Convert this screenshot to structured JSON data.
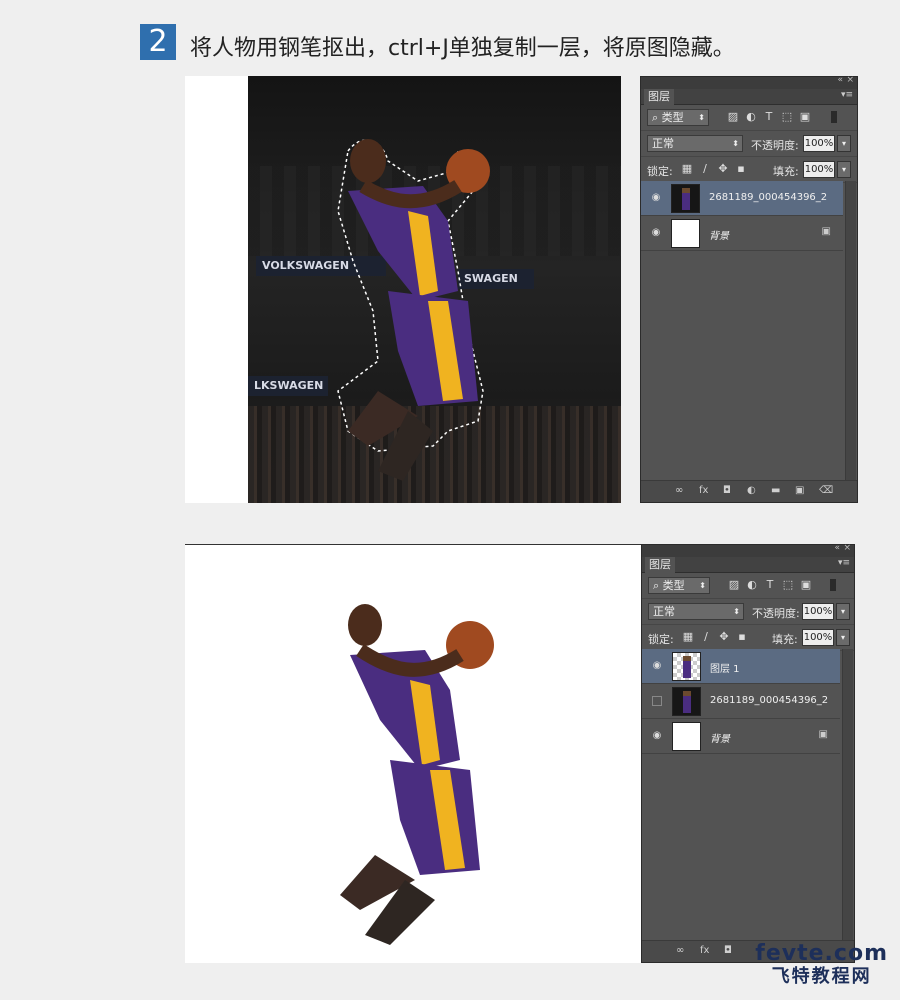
{
  "step": {
    "number": "2",
    "instruction": "将人物用钢笔抠出，ctrl+J单独复制一层，将原图隐藏。"
  },
  "canvas_top": {
    "banners": [
      "VOLKSWAGEN",
      "SWAGEN",
      "LKSWAGEN"
    ]
  },
  "panel_top": {
    "tab_label": "图层",
    "filter_label": "类型",
    "blend_mode": "正常",
    "opacity_label": "不透明度:",
    "opacity_value": "100%",
    "lock_label": "锁定:",
    "fill_label": "填充:",
    "fill_value": "100%",
    "layers": [
      {
        "name": "2681189_000454396_2",
        "visible": true,
        "selected": true,
        "thumb": "photo"
      },
      {
        "name": "背景",
        "visible": true,
        "selected": false,
        "thumb": "white",
        "locked": true
      }
    ]
  },
  "panel_bottom": {
    "tab_label": "图层",
    "filter_label": "类型",
    "blend_mode": "正常",
    "opacity_label": "不透明度:",
    "opacity_value": "100%",
    "lock_label": "锁定:",
    "fill_label": "填充:",
    "fill_value": "100%",
    "layers": [
      {
        "name": "图层 1",
        "visible": true,
        "selected": true,
        "thumb": "transparent"
      },
      {
        "name": "2681189_000454396_2",
        "visible": false,
        "selected": false,
        "thumb": "photo"
      },
      {
        "name": "背景",
        "visible": true,
        "selected": false,
        "thumb": "white",
        "locked": true
      }
    ]
  },
  "icons": {
    "collapse": "«",
    "close": "×",
    "panel_menu": "▾≡",
    "dropdown": "⬍",
    "eye": "👁",
    "lock": "🔒",
    "link": "∞",
    "fx": "fx",
    "mask": "◘",
    "adjust": "◐",
    "folder": "▬",
    "new": "▣",
    "trash": "🗑"
  },
  "watermark": {
    "domain": "fevte.com",
    "name": "飞特教程网"
  },
  "colors": {
    "badge": "#2f6fae",
    "panel": "#535353",
    "selected_layer": "#5b6b82",
    "jersey_purple": "#4a2d80",
    "jersey_gold": "#f0b320",
    "watermark": "#1d2f5a"
  }
}
